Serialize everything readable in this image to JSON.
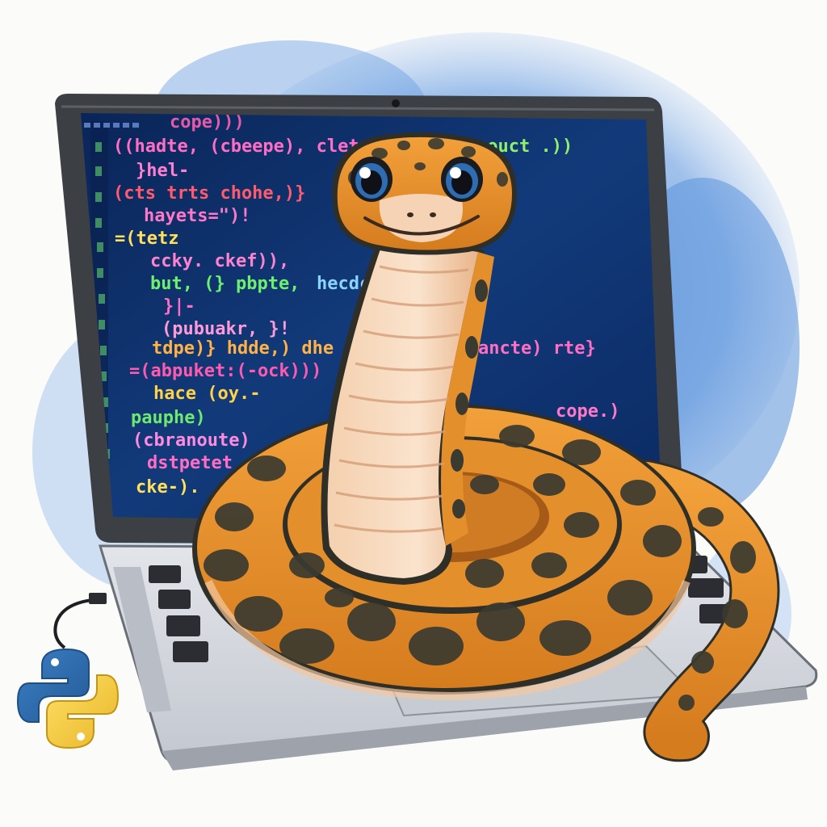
{
  "colors": {
    "background": "#fbfbfa",
    "watercolor_wash": "#5b93dd",
    "laptop_frame": "#3c3f44",
    "screen": "#0d2a5e",
    "keyboard_deck": "#d6d9de",
    "snake_base": "#e9902b",
    "snake_spots": "#3b3a30",
    "snake_belly": "#f6d9be",
    "python_blue": "#2e6db3",
    "python_yellow": "#f1cc35"
  },
  "icons": {
    "python_logo": "python-logo-icon",
    "cable": "usb-cable-icon",
    "webcam": "webcam-icon"
  },
  "screen": {
    "code_lines": [
      {
        "text": "cope)))",
        "color": "#e45aa8"
      },
      {
        "text": "((hadte,  (cbeepe), clet",
        "color": "#ff6ec4"
      },
      {
        "text": "couct .))",
        "color": "#8ef06a"
      },
      {
        "text": "}hel-",
        "color": "#ff7fd1"
      },
      {
        "text": "(cts trts chohe,)}",
        "color": "#ff5a6e"
      },
      {
        "text": "hayets=\")!",
        "color": "#ff78c8"
      },
      {
        "text": "=(tetz",
        "color": "#ffe05a"
      },
      {
        "text": "ccky. ckef)),",
        "color": "#ff82d0"
      },
      {
        "text": "but, (} pbpte,",
        "color": "#6ef06e"
      },
      {
        "text": "hecdce",
        "color": "#8ad4ff"
      },
      {
        "text": "}|-",
        "color": "#ff6ec4"
      },
      {
        "text": "(pubuakr, }!",
        "color": "#ff9ad8"
      },
      {
        "text": "tdpe)} hdde,) dhe",
        "color": "#ffb347"
      },
      {
        "text": "ancte) rte}",
        "color": "#ff6ec4"
      },
      {
        "text": "=(abpuket:(-ock)))",
        "color": "#ff5ab0"
      },
      {
        "text": "hace (oy.-",
        "color": "#ffd24a"
      },
      {
        "text": "pauphe)",
        "color": "#6ee86e"
      },
      {
        "text": "cope.)",
        "color": "#ff78c8"
      },
      {
        "text": "(cbranoute)",
        "color": "#ff8ae0"
      },
      {
        "text": "dstpetet",
        "color": "#ff6ec4"
      },
      {
        "text": "cke-).",
        "color": "#ffe05a"
      }
    ]
  }
}
